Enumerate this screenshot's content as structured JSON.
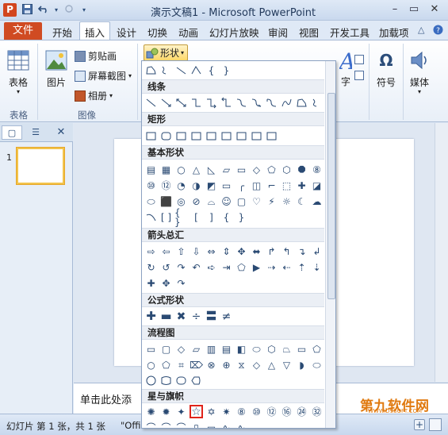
{
  "window": {
    "title": "演示文稿1 - Microsoft PowerPoint",
    "app_icon_letter": "P"
  },
  "quick_access": {
    "save": "save-icon",
    "undo": "undo-icon",
    "redo": "redo-icon",
    "customize": "dropdown-icon"
  },
  "tabs": {
    "file": "文件",
    "items": [
      "开始",
      "插入",
      "设计",
      "切换",
      "动画",
      "幻灯片放映",
      "审阅",
      "视图",
      "开发工具",
      "加载项"
    ],
    "active": "插入"
  },
  "ribbon": {
    "table_button": "表格",
    "picture_button": "图片",
    "clipart": "剪贴画",
    "screenshot": "屏幕截图",
    "album": "相册",
    "shapes_button": "形状",
    "group_table": "表格",
    "group_images": "图像",
    "text_partial": "字",
    "symbol": "符号",
    "media": "媒体",
    "omega": "Ω"
  },
  "shapes_menu": {
    "sections": [
      "线条",
      "矩形",
      "基本形状",
      "箭头总汇",
      "公式形状",
      "流程图",
      "星与旗帜"
    ],
    "basic_text_glyphs": [
      "{",
      "}",
      "[",
      "]",
      "{",
      "}",
      "{",
      "}"
    ]
  },
  "slides_panel": {
    "slide_number": "1"
  },
  "notes": {
    "placeholder": "单击此处添"
  },
  "status": {
    "slide_info": "幻灯片 第 1 张，共 1 张",
    "theme_partial": "\"Offi"
  },
  "watermark": {
    "text": "第九软件网",
    "sub": "WWW.D9SOFT.COM"
  },
  "colors": {
    "file_tab": "#d04b22",
    "selection": "#e0241b",
    "accent": "#2a4a73"
  }
}
